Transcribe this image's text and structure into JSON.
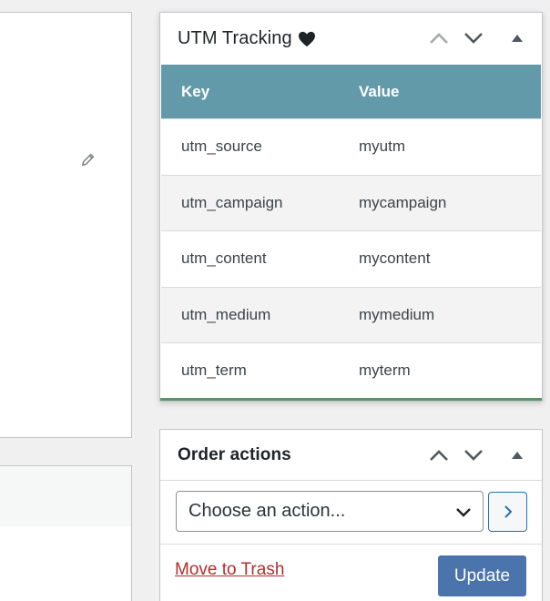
{
  "utm_box": {
    "title": "UTM Tracking",
    "title_icon": "heart-icon",
    "controls": [
      "move-up-icon",
      "move-down-icon",
      "toggle-panel-icon"
    ],
    "table": {
      "headers": {
        "key": "Key",
        "value": "Value"
      },
      "header_color": "#639aaa",
      "rows": [
        {
          "key": "utm_source",
          "value": "myutm"
        },
        {
          "key": "utm_campaign",
          "value": "mycampaign"
        },
        {
          "key": "utm_content",
          "value": "mycontent"
        },
        {
          "key": "utm_medium",
          "value": "mymedium"
        },
        {
          "key": "utm_term",
          "value": "myterm"
        }
      ]
    }
  },
  "order_actions": {
    "title": "Order actions",
    "select": {
      "selected": "Choose an action..."
    },
    "go_icon": "chevron-right-icon",
    "trash_label": "Move to Trash",
    "update_label": "Update",
    "accent_color": "#4b74ad",
    "trash_color": "#b32d2e"
  },
  "left_panel": {
    "edit_icon": "pencil-icon"
  }
}
